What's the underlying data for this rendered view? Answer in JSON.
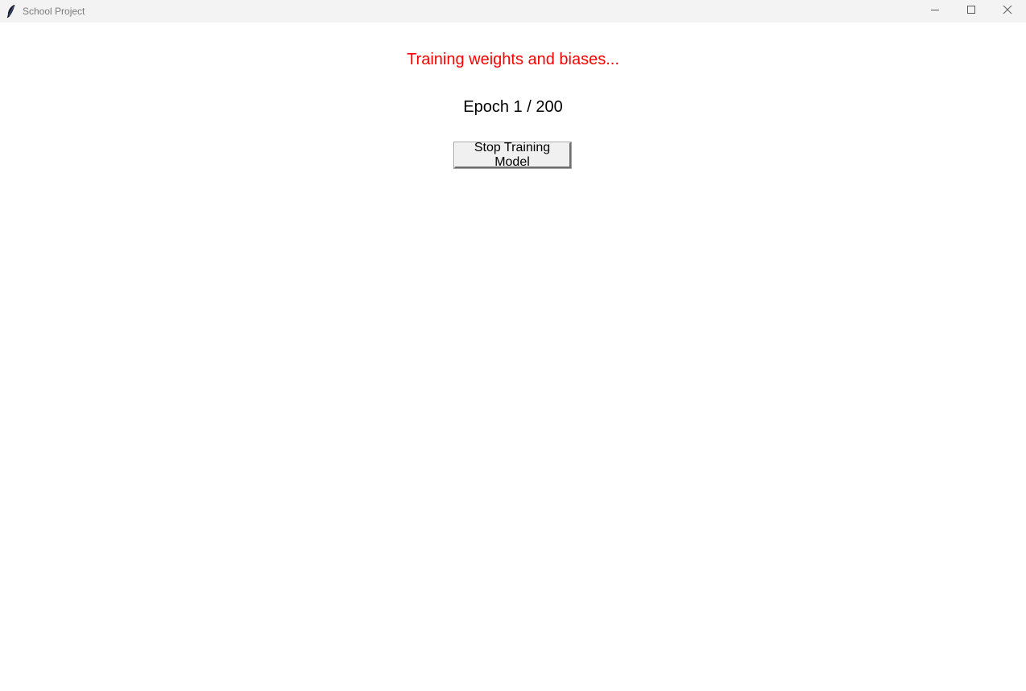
{
  "window": {
    "title": "School Project",
    "controls": {
      "minimize_icon": "minimize-icon",
      "maximize_icon": "maximize-icon",
      "close_icon": "close-icon"
    },
    "app_icon": "feather-icon"
  },
  "main": {
    "status_text": "Training weights and biases...",
    "status_color": "#ff0000",
    "epoch_text": "Epoch 1 / 200",
    "stop_button_label": "Stop Training Model"
  }
}
